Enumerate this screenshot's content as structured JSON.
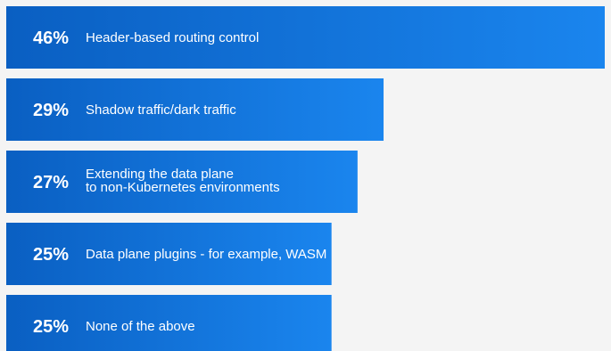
{
  "chart_data": {
    "type": "bar",
    "orientation": "horizontal",
    "value_format": "percent",
    "xlim": [
      0,
      46
    ],
    "bars": [
      {
        "value": 46,
        "value_label": "46%",
        "label_lines": [
          "Header-based routing control"
        ]
      },
      {
        "value": 29,
        "value_label": "29%",
        "label_lines": [
          "Shadow traffic/dark traffic"
        ]
      },
      {
        "value": 27,
        "value_label": "27%",
        "label_lines": [
          "Extending the data plane",
          "to non-Kubernetes environments"
        ]
      },
      {
        "value": 25,
        "value_label": "25%",
        "label_lines": [
          "Data plane plugins - for example, WASM"
        ]
      },
      {
        "value": 25,
        "value_label": "25%",
        "label_lines": [
          "None of the above"
        ]
      }
    ],
    "colors": {
      "bar_left": "#0a5fc2",
      "bar_right": "#1a85ee",
      "text": "#ffffff",
      "background": "#f4f4f4"
    }
  }
}
